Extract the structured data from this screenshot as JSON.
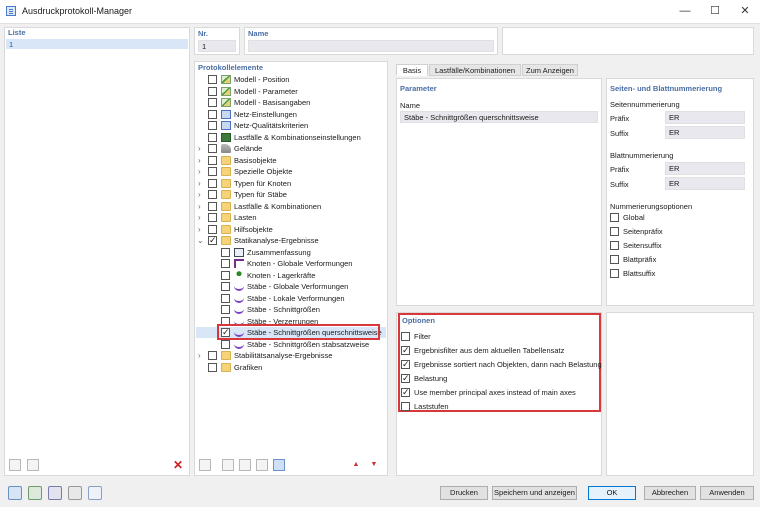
{
  "window": {
    "title": "Ausdruckprotokoll-Manager",
    "minimize": "—",
    "maximize": "☐",
    "close": "✕"
  },
  "list": {
    "header": "Liste",
    "items": [
      "1"
    ]
  },
  "nr": {
    "label": "Nr.",
    "value": "1"
  },
  "name": {
    "label": "Name",
    "value": ""
  },
  "tree": {
    "header": "Protokollelemente",
    "items": [
      {
        "label": "Modell - Position",
        "icon": "model-icon"
      },
      {
        "label": "Modell - Parameter",
        "icon": "model-icon"
      },
      {
        "label": "Modell - Basisangaben",
        "icon": "model-icon"
      },
      {
        "label": "Netz-Einstellungen",
        "icon": "mesh-icon"
      },
      {
        "label": "Netz-Qualitätskriterien",
        "icon": "mesh-icon"
      },
      {
        "label": "Lastfälle & Kombinationseinstellungen",
        "icon": "loadcase-icon"
      },
      {
        "label": "Gelände",
        "icon": "terrain-icon"
      },
      {
        "label": "Basisobjekte",
        "icon": "folder-icon"
      },
      {
        "label": "Spezielle Objekte",
        "icon": "folder-icon"
      },
      {
        "label": "Typen für Knoten",
        "icon": "folder-icon"
      },
      {
        "label": "Typen für Stäbe",
        "icon": "folder-icon"
      },
      {
        "label": "Lastfälle & Kombinationen",
        "icon": "folder-icon"
      },
      {
        "label": "Lasten",
        "icon": "folder-icon"
      },
      {
        "label": "Hilfsobjekte",
        "icon": "folder-icon"
      },
      {
        "label": "Statikanalyse-Ergebnisse",
        "icon": "folder-icon"
      },
      {
        "label": "Zusammenfassung",
        "icon": "summary-icon"
      },
      {
        "label": "Knoten - Globale Verformungen",
        "icon": "node-icon"
      },
      {
        "label": "Knoten - Lagerkräfte",
        "icon": "support-icon"
      },
      {
        "label": "Stäbe - Globale Verformungen",
        "icon": "member-icon"
      },
      {
        "label": "Stäbe - Lokale Verformungen",
        "icon": "member-icon"
      },
      {
        "label": "Stäbe - Schnittgrößen",
        "icon": "member-icon"
      },
      {
        "label": "Stäbe - Verzerrungen",
        "icon": "member-icon"
      },
      {
        "label": "Stäbe - Schnittgrößen querschnittsweise",
        "icon": "member-icon"
      },
      {
        "label": "Stäbe - Schnittgrößen stabsatzweise",
        "icon": "member-icon"
      },
      {
        "label": "Stabilitätsanalyse-Ergebnisse",
        "icon": "folder-icon"
      },
      {
        "label": "Grafiken",
        "icon": "folder-icon"
      }
    ]
  },
  "tabs": [
    "Basis",
    "Lastfälle/Kombinationen",
    "Zum Anzeigen"
  ],
  "parameter": {
    "header": "Parameter",
    "name_label": "Name",
    "name_value": "Stäbe - Schnittgrößen querschnittsweise"
  },
  "numbering": {
    "header": "Seiten- und Blattnummerierung",
    "page_header": "Seitennummerierung",
    "page_prefix_label": "Präfix",
    "page_prefix_value": "ER",
    "page_suffix_label": "Suffix",
    "page_suffix_value": "ER",
    "sheet_header": "Blattnummerierung",
    "sheet_prefix_label": "Präfix",
    "sheet_prefix_value": "ER",
    "sheet_suffix_label": "Suffix",
    "sheet_suffix_value": "ER",
    "options_header": "Nummerierungsoptionen",
    "options": [
      {
        "label": "Global",
        "checked": false
      },
      {
        "label": "Seitenpräfix",
        "checked": false
      },
      {
        "label": "Seitensuffix",
        "checked": false
      },
      {
        "label": "Blattpräfix",
        "checked": false
      },
      {
        "label": "Blattsuffix",
        "checked": false
      }
    ]
  },
  "options": {
    "header": "Optionen",
    "items": [
      {
        "label": "Filter",
        "checked": false
      },
      {
        "label": "Ergebnisfilter aus dem aktuellen Tabellensatz",
        "checked": true
      },
      {
        "label": "Ergebnisse sortiert nach Objekten, dann nach Belastung",
        "checked": true
      },
      {
        "label": "Belastung",
        "checked": true
      },
      {
        "label": "Use member principal axes instead of main axes",
        "checked": true
      },
      {
        "label": "Laststufen",
        "checked": false
      }
    ]
  },
  "buttons": {
    "print": "Drucken",
    "save_show": "Speichern und anzeigen",
    "ok": "OK",
    "cancel": "Abbrechen",
    "apply": "Anwenden"
  },
  "colors": {
    "accent": "#4a6fa5",
    "highlight": "#d9383a",
    "selection": "#d8e6f7"
  }
}
